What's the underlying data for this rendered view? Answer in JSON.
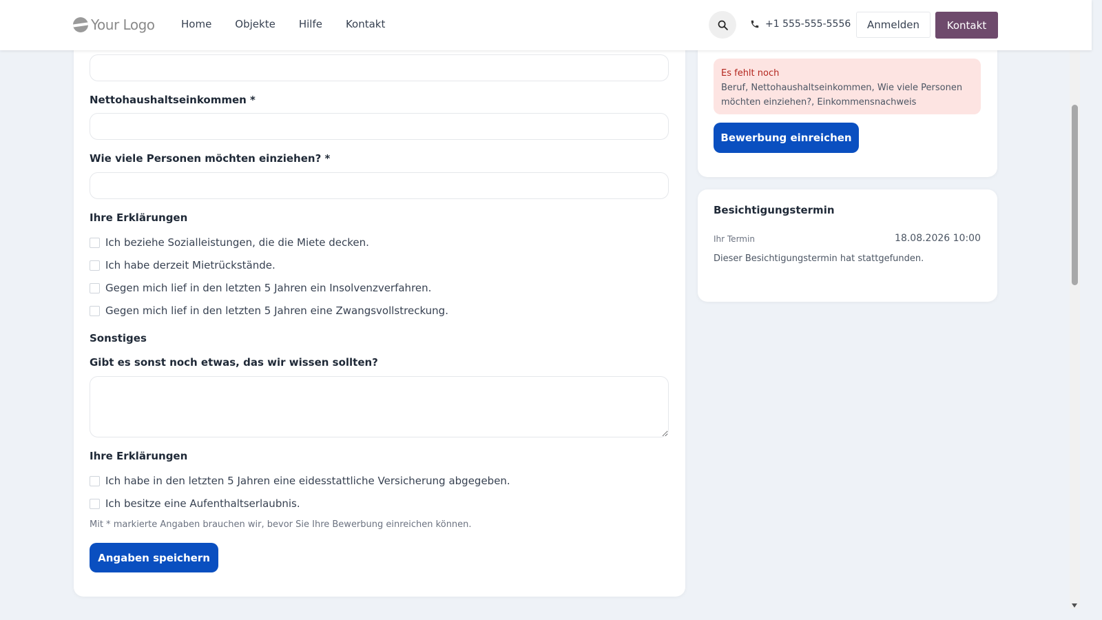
{
  "header": {
    "logo_text": "Your Logo",
    "nav": [
      "Home",
      "Objekte",
      "Hilfe",
      "Kontakt"
    ],
    "phone": "+1 555-555-5556",
    "login_label": "Anmelden",
    "contact_label": "Kontakt",
    "accent_color": "#6e4a6c"
  },
  "form": {
    "income_label": "Nettohaushaltseinkommen *",
    "persons_label": "Wie viele Personen möchten einziehen? *",
    "declarations1_heading": "Ihre Erklärungen",
    "declarations1": [
      "Ich beziehe Sozialleistungen, die die Miete decken.",
      "Ich habe derzeit Mietrückstände.",
      "Gegen mich lief in den letzten 5 Jahren ein Insolvenzverfahren.",
      "Gegen mich lief in den letzten 5 Jahren eine Zwangsvollstreckung."
    ],
    "misc_heading": "Sonstiges",
    "misc_question": "Gibt es sonst noch etwas, das wir wissen sollten?",
    "declarations2_heading": "Ihre Erklärungen",
    "declarations2": [
      "Ich habe in den letzten 5 Jahren eine eidesstattliche Versicherung abgegeben.",
      "Ich besitze eine Aufenthaltserlaubnis."
    ],
    "hint": "Mit * markierte Angaben brauchen wir, bevor Sie Ihre Bewerbung einreichen können.",
    "save_label": "Angaben speichern",
    "primary_color": "#0a4fc0"
  },
  "status": {
    "missing_title": "Es fehlt noch",
    "missing_body": "Beruf, Nettohaushaltseinkommen, Wie viele Personen möchten einziehen?, Einkommensnachweis",
    "submit_label": "Bewerbung einreichen"
  },
  "appointment": {
    "title": "Besichtigungstermin",
    "label": "Ihr Termin",
    "datetime": "18.08.2026 10:00",
    "note": "Dieser Besichtigungstermin hat stattgefunden."
  }
}
